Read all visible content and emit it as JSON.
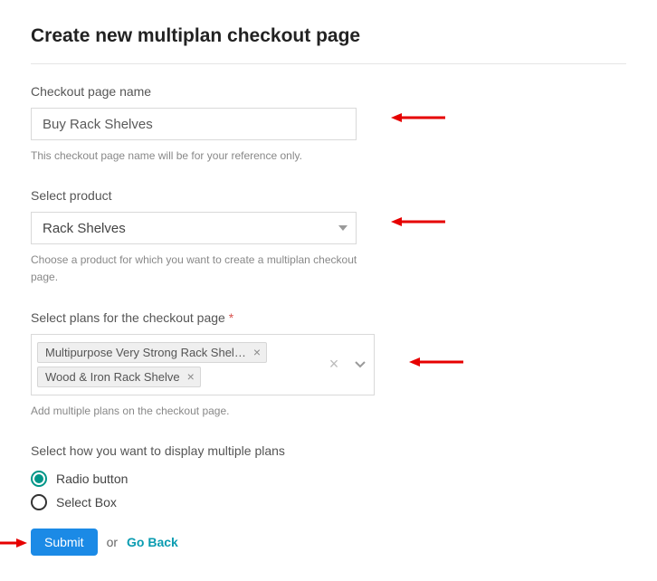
{
  "title": "Create new multiplan checkout page",
  "checkoutName": {
    "label": "Checkout page name",
    "value": "Buy Rack Shelves",
    "help": "This checkout page name will be for your reference only."
  },
  "product": {
    "label": "Select product",
    "value": "Rack Shelves",
    "help": "Choose a product for which you want to create a multiplan checkout page."
  },
  "plans": {
    "label": "Select plans for the checkout page",
    "chips": [
      "Multipurpose Very Strong Rack Shel…",
      "Wood & Iron Rack Shelve"
    ],
    "help": "Add multiple plans on the checkout page."
  },
  "display": {
    "label": "Select how you want to display multiple plans",
    "options": [
      {
        "label": "Radio button",
        "selected": true
      },
      {
        "label": "Select Box",
        "selected": false
      }
    ]
  },
  "actions": {
    "submit": "Submit",
    "or": "or",
    "goBack": "Go Back"
  }
}
